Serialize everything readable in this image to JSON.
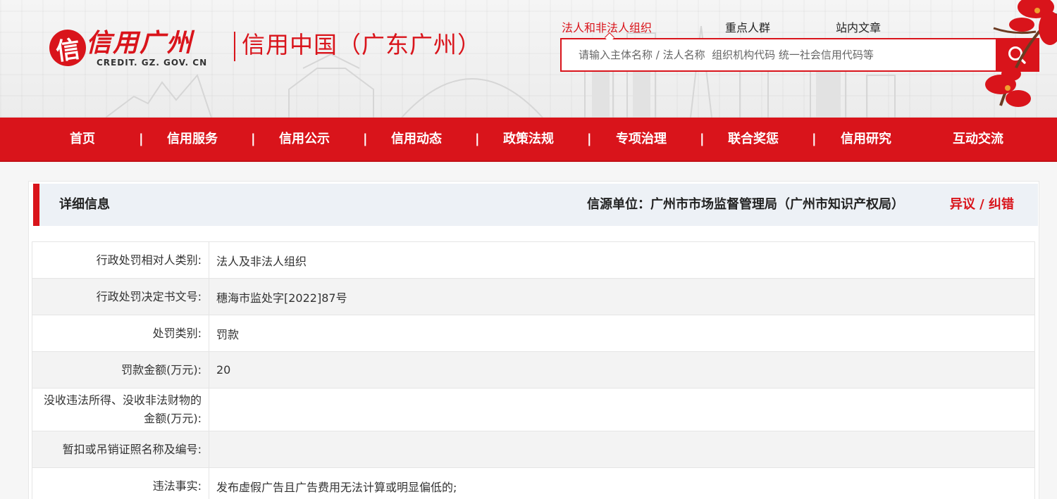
{
  "header": {
    "logo_char": "信",
    "logo_title": "信用广州",
    "logo_domain": "CREDIT. GZ. GOV. CN",
    "logo_subtitle": "信用中国（广东广州）"
  },
  "search": {
    "tabs": [
      {
        "label": "法人和非法人组织",
        "active": true
      },
      {
        "label": "重点人群",
        "active": false
      },
      {
        "label": "站内文章",
        "active": false
      }
    ],
    "placeholder": "请输入主体名称 / 法人名称  组织机构代码 统一社会信用代码等",
    "button_icon": "search-icon"
  },
  "nav": {
    "items": [
      "首页",
      "信用服务",
      "信用公示",
      "信用动态",
      "政策法规",
      "专项治理",
      "联合奖惩",
      "信用研究",
      "互动交流"
    ],
    "separator": "|"
  },
  "panel": {
    "title": "详细信息",
    "source_label": "信源单位：",
    "source_value": "广州市市场监督管理局（广州市知识产权局）",
    "objection": "异议 / 纠错"
  },
  "details": [
    {
      "label": "行政处罚相对人类别:",
      "value": "法人及非法人组织"
    },
    {
      "label": "行政处罚决定书文号:",
      "value": "穗海市监处字[2022]87号"
    },
    {
      "label": "处罚类别:",
      "value": "罚款"
    },
    {
      "label": "罚款金额(万元):",
      "value": "20"
    },
    {
      "label": "没收违法所得、没收非法财物的金额(万元):",
      "value": ""
    },
    {
      "label": "暂扣或吊销证照名称及编号:",
      "value": ""
    },
    {
      "label": "违法事实:",
      "value": "发布虚假广告且广告费用无法计算或明显偏低的;"
    }
  ],
  "colors": {
    "brand_red": "#d9141b",
    "panel_head_bg": "#edf1f6"
  }
}
